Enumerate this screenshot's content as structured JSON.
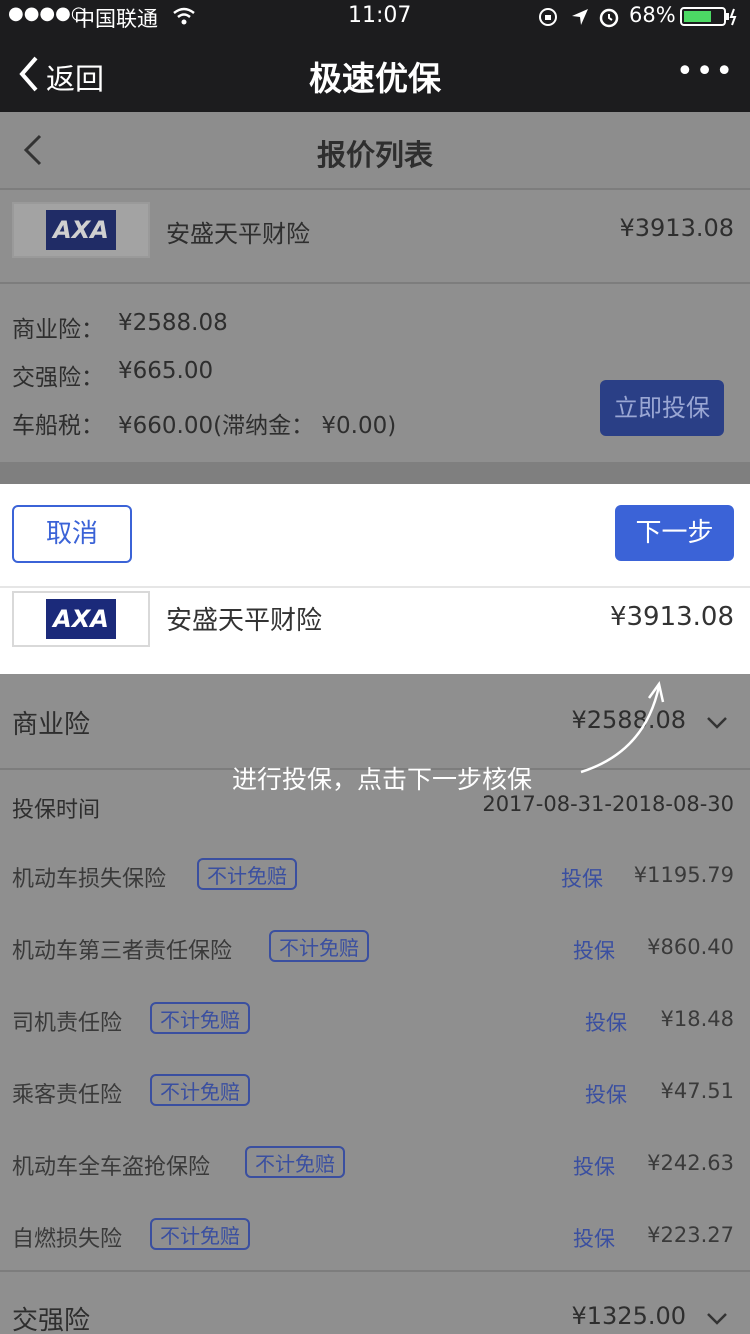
{
  "status_bar": {
    "signal": "●●●●○",
    "carrier": "中国联通",
    "time": "11:07",
    "battery": "68%"
  },
  "nav": {
    "back_label": "返回",
    "title": "极速优保",
    "more_label": "•••"
  },
  "page": {
    "title": "报价列表"
  },
  "insurer": {
    "logo_text": "AXA",
    "name": "安盛天平财险",
    "total": "¥3913.08"
  },
  "summary": {
    "commercial_label": "商业险：",
    "commercial_value": "¥2588.08",
    "compulsory_label": "交强险：",
    "compulsory_value": "¥665.00",
    "tax_label": "车船税：",
    "tax_value": "¥660.00(滞纳金：  ¥0.00)",
    "buy_button": "立即投保"
  },
  "panel": {
    "cancel_label": "取消",
    "next_label": "下一步",
    "name": "安盛天平财险",
    "total": "¥3913.08"
  },
  "commercial": {
    "label": "商业险",
    "total": "¥2588.08"
  },
  "tooltip": "进行投保，点击下一步核保",
  "period": {
    "label": "投保时间",
    "value": "2017-08-31-2018-08-30"
  },
  "coverages": [
    {
      "name": "机动车损失保险",
      "tag": "不计免赔",
      "action": "投保",
      "price": "¥1195.79"
    },
    {
      "name": "机动车第三者责任保险",
      "tag": "不计免赔",
      "action": "投保",
      "price": "¥860.40"
    },
    {
      "name": "司机责任险",
      "tag": "不计免赔",
      "action": "投保",
      "price": "¥18.48"
    },
    {
      "name": "乘客责任险",
      "tag": "不计免赔",
      "action": "投保",
      "price": "¥47.51"
    },
    {
      "name": "机动车全车盗抢保险",
      "tag": "不计免赔",
      "action": "投保",
      "price": "¥242.63"
    },
    {
      "name": "自燃损失险",
      "tag": "不计免赔",
      "action": "投保",
      "price": "¥223.27"
    }
  ],
  "compulsory": {
    "label": "交强险",
    "total": "¥1325.00"
  },
  "colors": {
    "accent": "#3b63d7",
    "overlay": "#8d8d8d",
    "nav_bg": "#1c1c1e"
  }
}
